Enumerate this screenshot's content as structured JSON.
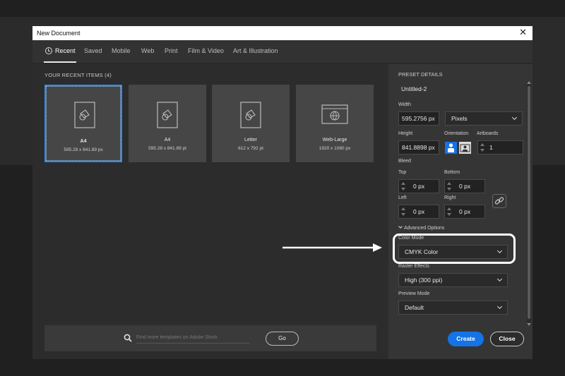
{
  "window": {
    "title": "New Document",
    "close_glyph": "✕"
  },
  "tabs": [
    {
      "label": "Recent",
      "icon": "clock-icon",
      "active": true
    },
    {
      "label": "Saved"
    },
    {
      "label": "Mobile"
    },
    {
      "label": "Web"
    },
    {
      "label": "Print"
    },
    {
      "label": "Film & Video"
    },
    {
      "label": "Art & Illustration"
    }
  ],
  "recent": {
    "heading": "YOUR RECENT ITEMS",
    "count": "(4)",
    "items": [
      {
        "name": "A4",
        "size": "595.28 x 841.89 px",
        "icon": "document-icon",
        "selected": true
      },
      {
        "name": "A4",
        "size": "595.28 x 841.89 pt",
        "icon": "document-icon"
      },
      {
        "name": "Letter",
        "size": "612 x 792 pt",
        "icon": "document-icon"
      },
      {
        "name": "Web-Large",
        "size": "1920 x 1080 px",
        "icon": "web-icon"
      }
    ]
  },
  "search": {
    "placeholder": "Find more templates on Adobe Stock",
    "go_label": "Go"
  },
  "preset": {
    "heading": "PRESET DETAILS",
    "doc_name": "Untitled-2",
    "width_label": "Width",
    "width_value": "595.2756 px",
    "unit": "Pixels",
    "height_label": "Height",
    "height_value": "841.8898 px",
    "orientation_label": "Orientation",
    "artboards_label": "Artboards",
    "artboards_value": "1",
    "bleed_label": "Bleed",
    "top_label": "Top",
    "top_value": "0 px",
    "bottom_label": "Bottom",
    "bottom_value": "0 px",
    "left_label": "Left",
    "left_value": "0 px",
    "right_label": "Right",
    "right_value": "0 px",
    "advanced_label": "Advanced Options",
    "color_mode_label": "Color Mode",
    "color_mode_value": "CMYK Color",
    "raster_label": "Raster Effects",
    "raster_value": "High (300 ppi)",
    "preview_label": "Preview Mode",
    "preview_value": "Default"
  },
  "buttons": {
    "create": "Create",
    "close": "Close"
  },
  "colors": {
    "accent": "#1473e6",
    "selection": "#2d8ceb",
    "panel": "#353535",
    "background": "#2c2c2c"
  }
}
